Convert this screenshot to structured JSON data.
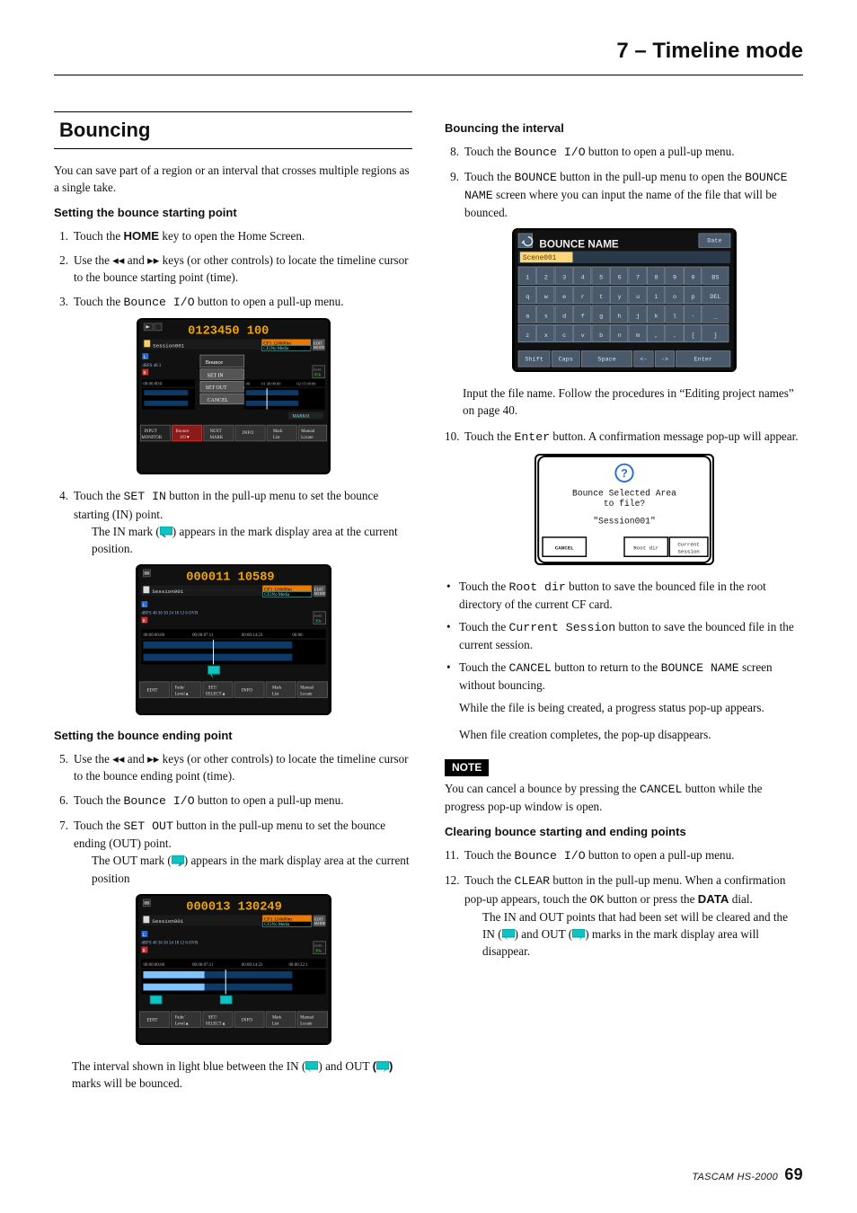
{
  "chapter": "7 – Timeline mode",
  "footer": {
    "brand": "TASCAM HS-2000",
    "page": "69"
  },
  "left": {
    "heading": "Bouncing",
    "intro": "You can save part of a region or an interval that crosses multiple regions as a single take.",
    "sub1": "Setting the bounce starting point",
    "steps1": "Touch the ",
    "steps1b": " key to open the Home Screen.",
    "home": "HOME",
    "steps2a": "Use the ",
    "steps2b": " and ",
    "steps2c": " keys (or other controls) to locate the timeline cursor to the bounce starting point (time).",
    "steps3a": "Touch the ",
    "bio": "Bounce I/O",
    "steps3b": " button to open a pull-up menu.",
    "scr1": {
      "time": "0123450 100",
      "session": "Session001",
      "cf1": "CF1 124h00m",
      "cf2": "CF2No Media",
      "edit": "EDIT\nMODE",
      "btns": [
        "Bounce",
        "SET IN",
        "SET OUT",
        "CANCEL"
      ],
      "db": "dBFS 48 3",
      "zoom": "zoom\n05h",
      "tline": "00:00:00:0",
      "t1": "00",
      "t2": "01:30:00:00",
      "t3": "02:15:00:00",
      "mark": "MARK01",
      "bbar": [
        "INPUT\nMONITOR",
        "Bounce\nI/O",
        "NEXT\nMARK",
        "INFO",
        "Mark\nList",
        "Manual\nLocate"
      ]
    },
    "steps4a": "Touch the ",
    "setin": "SET IN",
    "steps4b": " button in the pull-up menu to set the bounce starting (IN) point.",
    "steps4detail": "The IN mark (",
    "steps4detail2": ") appears in the mark display area at the current position.",
    "scr2": {
      "time": "000011 10589",
      "session": "Session001",
      "cf1": "CF1 124h00m",
      "cf2": "CF2No Media",
      "edit": "EDIT\nMODE",
      "db": "dBFS 48 36  30  24  18  12  6   OVR",
      "zoom": "zoom\n30s",
      "t0": "00:00:00:00",
      "t1": "00:00:07:11",
      "t2": "00:00:14:23",
      "t3": "00:00:",
      "bbar": [
        "EDIT",
        "Fade/\nLevel",
        "SET/\nSELECT",
        "INFO",
        "Mark\nList",
        "Manual\nLocate"
      ]
    },
    "sub2": "Setting the bounce ending point",
    "steps5a": "Use the ",
    "steps5b": " and ",
    "steps5c": " keys (or other controls) to locate the timeline cursor to the bounce ending point (time).",
    "steps6a": "Touch the ",
    "steps6b": " button to open a pull-up menu.",
    "steps7a": "Touch the ",
    "setout": "SET OUT",
    "steps7b": " button in the pull-up menu to set the bounce ending (OUT) point.",
    "steps7detail": "The OUT mark (",
    "steps7detail2": ") appears in the mark display area at the current position",
    "scr3": {
      "time": "000013 130249",
      "session": "Session001",
      "cf1": "CF1 124h00m",
      "cf2": "CF2No Media",
      "edit": "EDIT\nMODE",
      "db": "dBFS 48 36  30  24  18  12  6   OVR",
      "zoom": "zoom\n30s",
      "t0": "00:00:00:00",
      "t1": "00:00:07:11",
      "t2": "00:00:14:23",
      "t3": "00:00:22:1",
      "bbar": [
        "EDIT",
        "Fade/\nLevel",
        "SET/\nSELECT",
        "INFO",
        "Mark\nList",
        "Manual\nLocate"
      ]
    },
    "tailA": "The interval shown in light blue between the IN (",
    "tailB": ") and OUT ",
    "tailC": " marks will be bounced."
  },
  "right": {
    "sub1": "Bouncing the interval",
    "s8a": "Touch the ",
    "s8b": " button to open a pull-up menu.",
    "s9a": "Touch the ",
    "bounce": "BOUNCE",
    "s9b": " button in the pull-up menu to open the ",
    "bname": "BOUNCE NAME",
    "s9c": " screen where you can input the name of the file that will be bounced.",
    "scr4": {
      "title": "BOUNCE NAME",
      "date": "Date",
      "field": "Scene001",
      "rows": [
        [
          "1",
          "2",
          "3",
          "4",
          "5",
          "6",
          "7",
          "8",
          "9",
          "0",
          "BS"
        ],
        [
          "q",
          "w",
          "e",
          "r",
          "t",
          "y",
          "u",
          "i",
          "o",
          "p",
          "DEL"
        ],
        [
          "a",
          "s",
          "d",
          "f",
          "g",
          "h",
          "j",
          "k",
          "l",
          "-",
          "_"
        ],
        [
          "z",
          "x",
          "c",
          "v",
          "b",
          "n",
          "m",
          ",",
          ".",
          "[",
          "]"
        ]
      ],
      "brow": [
        "Shift",
        "Caps",
        "Space",
        "<-",
        "->",
        "Enter"
      ]
    },
    "s9d": "Input the file name. Follow the procedures in “Editing project names” on page 40.",
    "s10a": "Touch the ",
    "enter": "Enter",
    "s10b": " button. A confirmation message pop-up will appear.",
    "scr5": {
      "line1": "Bounce Selected Area",
      "line2": "to file?",
      "file": "\"Session001\"",
      "btns": [
        "CANCEL",
        "Root dir",
        "Current\nSession"
      ]
    },
    "bulA1": "Touch the ",
    "rootdir": "Root dir",
    "bulA2": " button to save the bounced file in the root directory of the current CF card.",
    "bulB1": "Touch the ",
    "cursess": "Current Session",
    "bulB2": " button to save the bounced file in the current session.",
    "bulC1": "Touch the ",
    "cancel": "CANCEL",
    "bulC2": " button to return to the ",
    "bulC3": " screen without bouncing.",
    "tail1": "While the file is being created, a progress status pop-up appears.",
    "tail2": "When file creation completes, the pop-up disappears.",
    "note": "NOTE",
    "noteText1": "You can cancel a bounce by pressing the ",
    "noteText2": " button while the progress pop-up window is open.",
    "sub2": "Clearing bounce starting and ending points",
    "s11a": "Touch the ",
    "s11b": " button to open a pull-up menu.",
    "s12a": "Touch the ",
    "clear": "CLEAR",
    "s12b": " button in the pull-up menu. When a confirmation pop-up appears, touch the ",
    "ok": "OK",
    "s12c": " button or press the ",
    "data": "DATA",
    "s12d": " dial.",
    "s12e": "The IN and OUT points that had been set will be cleared and the IN (",
    "s12f": ") and OUT (",
    "s12g": ") marks in the mark display area will disappear."
  },
  "icons": {
    "rew": "◂◂",
    "fwd": "▸▸"
  }
}
